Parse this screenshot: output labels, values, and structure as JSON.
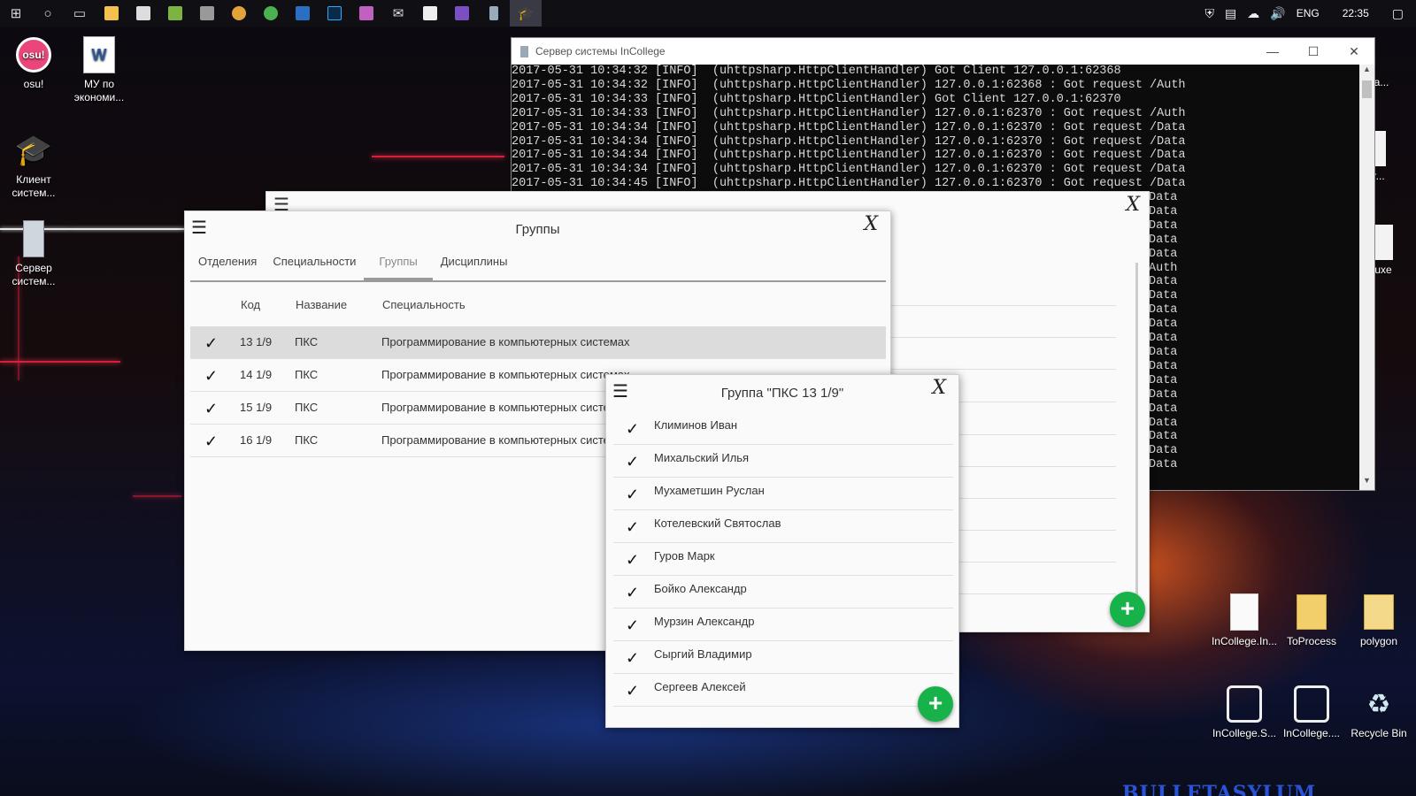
{
  "taskbar": {
    "icons": [
      "windows-start-icon",
      "cortana-icon",
      "task-view-icon",
      "file-explorer-icon",
      "store-icon",
      "android-studio-icon",
      "database-icon",
      "chrome-canary-icon",
      "chrome-icon",
      "app-icon",
      "photoshop-icon",
      "paint-icon",
      "mail-icon",
      "photos-icon",
      "visual-studio-icon",
      "phone-icon",
      "incollege-icon"
    ],
    "language": "ENG",
    "clock": "22:35"
  },
  "desktop_icons_left": [
    {
      "label": "osu!"
    },
    {
      "label": "МУ по экономи..."
    },
    {
      "label": "Клиент систем..."
    },
    {
      "label": "Сервер систем..."
    }
  ],
  "desktop_icons_right": [
    {
      "label": "eStrea..."
    },
    {
      "label": "-Sour..."
    },
    {
      "label": "eluxe"
    },
    {
      "label": "InCollege.In..."
    },
    {
      "label": "ToProcess"
    },
    {
      "label": "polygon"
    },
    {
      "label": "InCollege.S..."
    },
    {
      "label": "InCollege...."
    },
    {
      "label": "Recycle Bin"
    }
  ],
  "console": {
    "title": "Сервер системы InCollege",
    "lines": [
      "2017-05-31 10:34:32 [INFO]  (uhttpsharp.HttpClientHandler) Got Client 127.0.0.1:62368",
      "2017-05-31 10:34:32 [INFO]  (uhttpsharp.HttpClientHandler) 127.0.0.1:62368 : Got request /Auth",
      "2017-05-31 10:34:33 [INFO]  (uhttpsharp.HttpClientHandler) Got Client 127.0.0.1:62370",
      "2017-05-31 10:34:33 [INFO]  (uhttpsharp.HttpClientHandler) 127.0.0.1:62370 : Got request /Auth",
      "2017-05-31 10:34:34 [INFO]  (uhttpsharp.HttpClientHandler) 127.0.0.1:62370 : Got request /Data",
      "2017-05-31 10:34:34 [INFO]  (uhttpsharp.HttpClientHandler) 127.0.0.1:62370 : Got request /Data",
      "2017-05-31 10:34:34 [INFO]  (uhttpsharp.HttpClientHandler) 127.0.0.1:62370 : Got request /Data",
      "2017-05-31 10:34:34 [INFO]  (uhttpsharp.HttpClientHandler) 127.0.0.1:62370 : Got request /Data",
      "2017-05-31 10:34:45 [INFO]  (uhttpsharp.HttpClientHandler) 127.0.0.1:62370 : Got request /Data"
    ],
    "tail_lines": [
      "Data",
      "Data",
      "Data",
      "Data",
      "Data",
      "Auth",
      "Data",
      "Data",
      "Data",
      "Data",
      "Data",
      "Data",
      "Data",
      "Data",
      "Data",
      "Data",
      "Data",
      "Data",
      "Data",
      "Data"
    ]
  },
  "groups_window": {
    "title": "Группы",
    "tabs": [
      "Отделения",
      "Специальности",
      "Группы",
      "Дисциплины"
    ],
    "active_tab": "Группы",
    "columns": [
      "Код",
      "Название",
      "Специальность"
    ],
    "rows": [
      {
        "code": "13 1/9",
        "name": "ПКС",
        "specialty": "Программирование в компьютерных системах",
        "selected": true
      },
      {
        "code": "14 1/9",
        "name": "ПКС",
        "specialty": "Программирование в компьютерных системах",
        "selected": false
      },
      {
        "code": "15 1/9",
        "name": "ПКС",
        "specialty": "Программирование в компьютерных системах",
        "selected": false
      },
      {
        "code": "16 1/9",
        "name": "ПКС",
        "specialty": "Программирование в компьютерных системах",
        "selected": false
      }
    ]
  },
  "members_window": {
    "title": "Группа \"ПКС 13 1/9\"",
    "students": [
      "Климинов Иван",
      "Михальский Илья",
      "Мухаметшин Руслан",
      "Котелевский Святослав",
      "Гуров Марк",
      "Бойко Александр",
      "Мурзин Александр",
      "Сыргий Владимир",
      "Сергеев Алексей"
    ]
  },
  "fab_symbol": "+",
  "check_symbol": "✓",
  "colors": {
    "fab": "#17b24a",
    "selected_row": "#dcdcdc"
  }
}
